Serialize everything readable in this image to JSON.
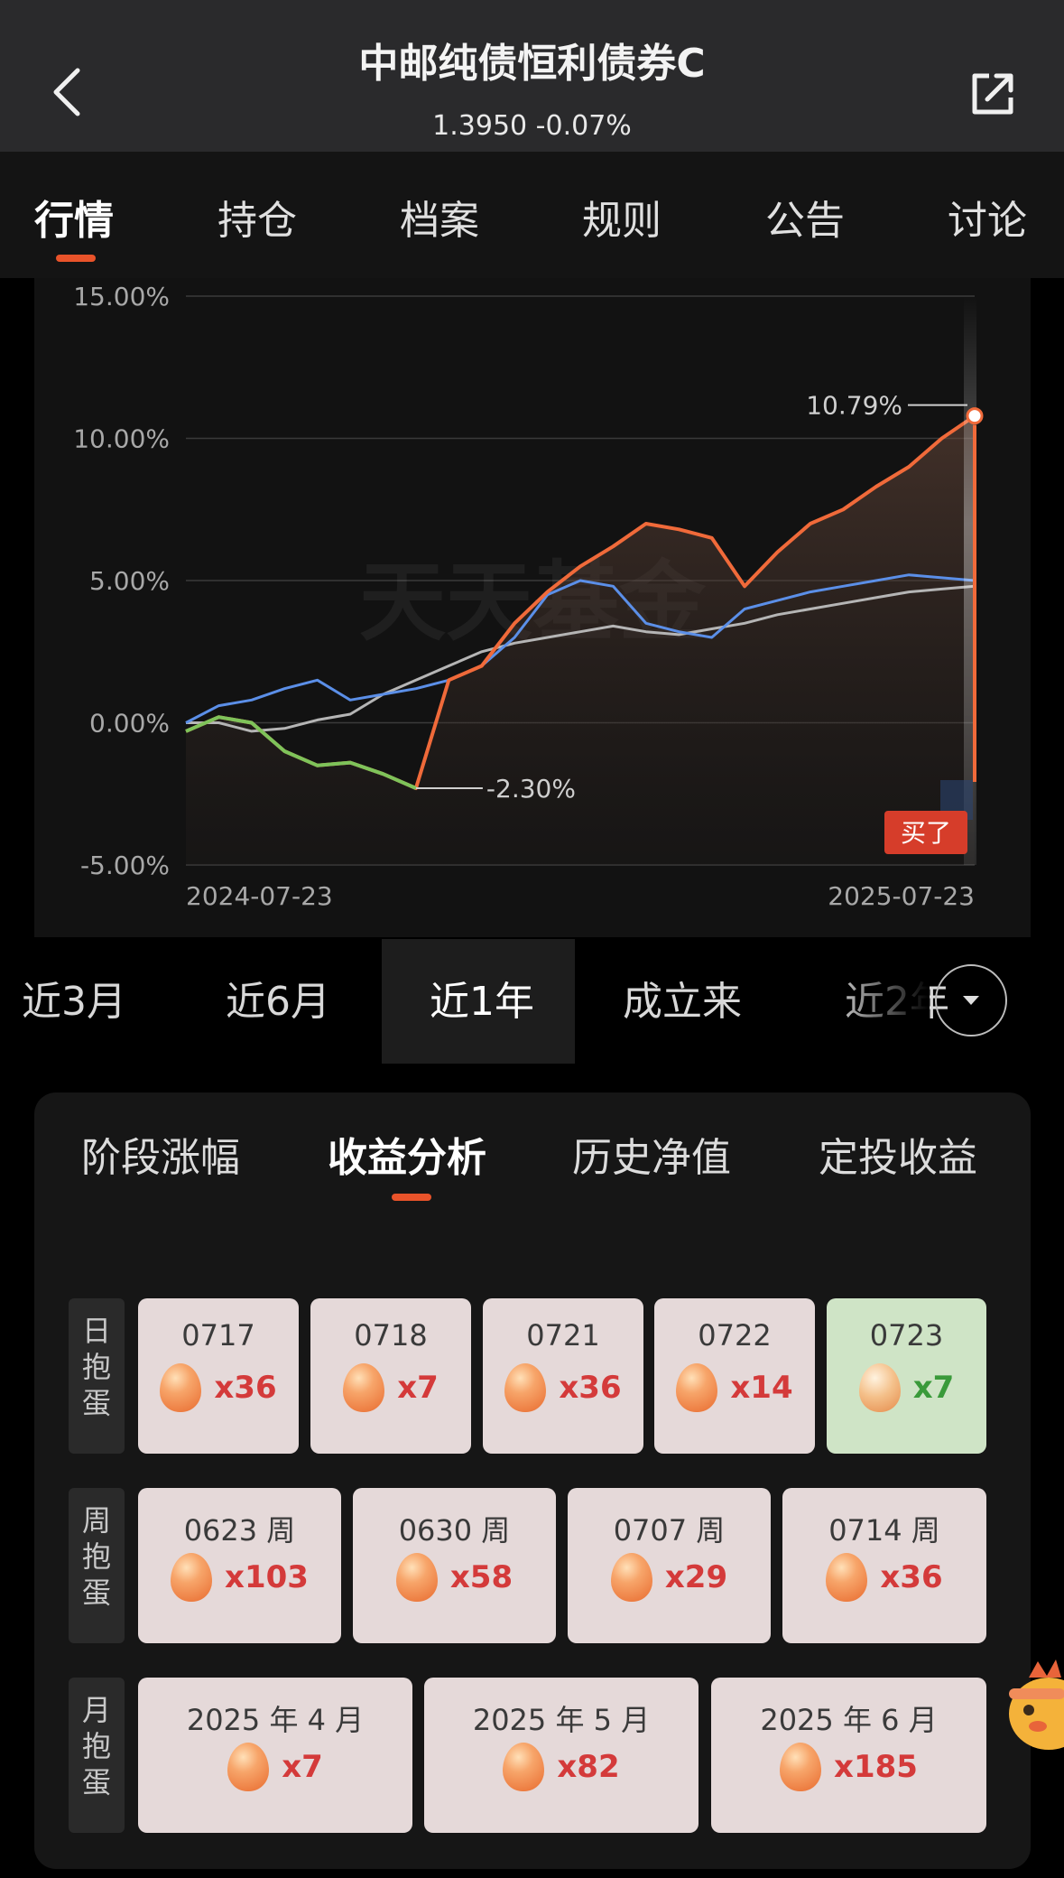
{
  "header": {
    "title": "中邮纯债恒利债券C",
    "subtitle": "1.3950  -0.07%"
  },
  "tabs": [
    "行情",
    "持仓",
    "档案",
    "规则",
    "公告",
    "讨论"
  ],
  "chart_data": {
    "type": "line",
    "y_ticks": [
      "15.00%",
      "10.00%",
      "5.00%",
      "0.00%",
      "-5.00%"
    ],
    "ylim": [
      -5,
      15
    ],
    "x_labels": [
      "2024-07-23",
      "2025-07-23"
    ],
    "watermark": "天天基金",
    "annotations": {
      "max": "10.79%",
      "min": "-2.30%"
    },
    "buy_marker": "买了",
    "colors": {
      "fund": "#f06a3a",
      "drawdown": "#7ec35a",
      "benchmark_blue": "#5b8fe8",
      "benchmark_gray": "#b5b5b5"
    },
    "series": [
      {
        "values": [
          -0.3,
          0.2,
          0.0,
          -1.0,
          -1.5,
          -1.4,
          -1.8,
          -2.3,
          1.5,
          2.0,
          3.5,
          4.6,
          5.5,
          6.2,
          7.0,
          6.8,
          6.5,
          4.8,
          6.0,
          7.0,
          7.5,
          8.3,
          9.0,
          10.0,
          10.79
        ]
      },
      {
        "values": [
          0.0,
          0.6,
          0.8,
          1.2,
          1.5,
          0.8,
          1.0,
          1.2,
          1.5,
          2.0,
          3.0,
          4.5,
          5.0,
          4.8,
          3.5,
          3.2,
          3.0,
          4.0,
          4.3,
          4.6,
          4.8,
          5.0,
          5.2,
          5.1,
          5.0
        ]
      },
      {
        "values": [
          0.0,
          0.0,
          -0.3,
          -0.2,
          0.1,
          0.3,
          1.0,
          1.5,
          2.0,
          2.5,
          2.8,
          3.0,
          3.2,
          3.4,
          3.2,
          3.1,
          3.3,
          3.5,
          3.8,
          4.0,
          4.2,
          4.4,
          4.6,
          4.7,
          4.8
        ]
      }
    ]
  },
  "periods": [
    "近3月",
    "近6月",
    "近1年",
    "成立来",
    "近2年"
  ],
  "active_period": "近1年",
  "analysis_tabs": [
    "阶段涨幅",
    "收益分析",
    "历史净值",
    "定投收益"
  ],
  "egg_rows": [
    {
      "label": "日抱蛋",
      "items": [
        {
          "date": "0717",
          "count": "x36",
          "state": "normal"
        },
        {
          "date": "0718",
          "count": "x7",
          "state": "normal"
        },
        {
          "date": "0721",
          "count": "x36",
          "state": "normal"
        },
        {
          "date": "0722",
          "count": "x14",
          "state": "normal"
        },
        {
          "date": "0723",
          "count": "x7",
          "state": "cracked"
        }
      ]
    },
    {
      "label": "周抱蛋",
      "items": [
        {
          "date": "0623 周",
          "count": "x103",
          "state": "normal"
        },
        {
          "date": "0630 周",
          "count": "x58",
          "state": "normal"
        },
        {
          "date": "0707 周",
          "count": "x29",
          "state": "normal"
        },
        {
          "date": "0714 周",
          "count": "x36",
          "state": "normal"
        }
      ]
    },
    {
      "label": "月抱蛋",
      "items": [
        {
          "date": "2025 年 4 月",
          "count": "x7",
          "state": "normal"
        },
        {
          "date": "2025 年 5 月",
          "count": "x82",
          "state": "normal"
        },
        {
          "date": "2025 年 6 月",
          "count": "x185",
          "state": "normal"
        }
      ]
    }
  ]
}
